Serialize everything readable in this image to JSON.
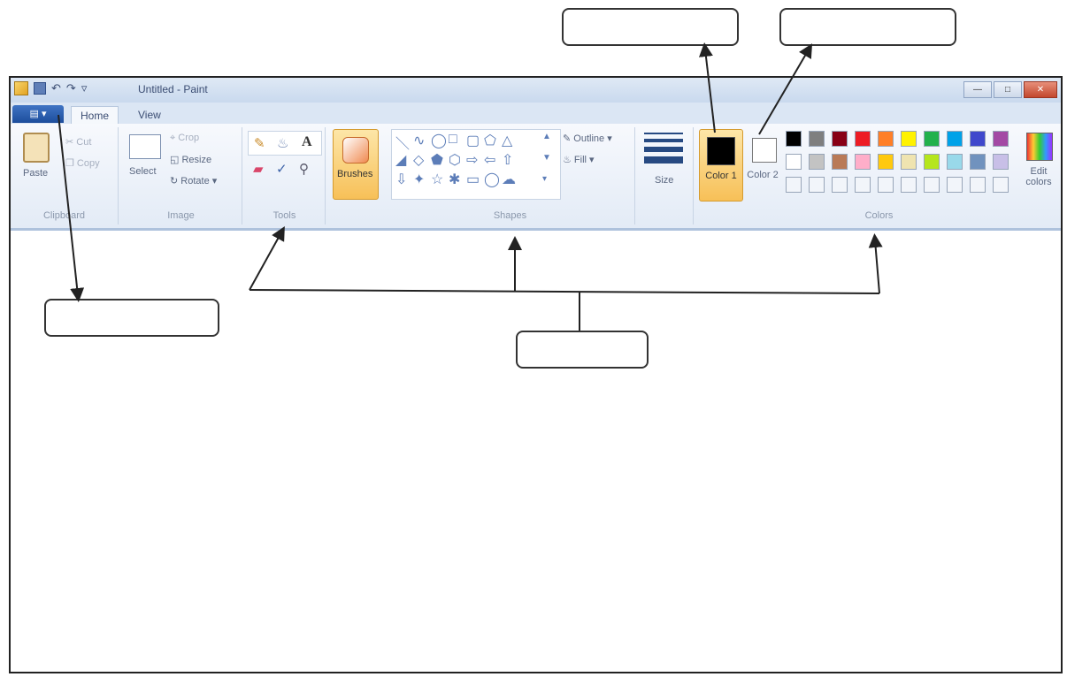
{
  "window": {
    "title": "Untitled - Paint",
    "controls": {
      "minimize": "—",
      "maximize": "□",
      "close": "✕"
    }
  },
  "file_menu": {
    "label": "▤ ▾"
  },
  "tabs": [
    {
      "label": "Home"
    },
    {
      "label": "View"
    }
  ],
  "ribbon": {
    "clipboard": {
      "label": "Clipboard",
      "paste": "Paste",
      "cut": "Cut",
      "copy": "Copy"
    },
    "image": {
      "label": "Image",
      "select": "Select",
      "crop": "Crop",
      "resize": "Resize",
      "rotate": "Rotate ▾"
    },
    "tools": {
      "label": "Tools"
    },
    "brushes": {
      "label": "Brushes"
    },
    "shapes": {
      "label": "Shapes",
      "outline": "Outline ▾",
      "fill": "Fill ▾"
    },
    "size": {
      "label": "Size"
    },
    "colors": {
      "label": "Colors",
      "color1": "Color 1",
      "color2": "Color 2",
      "edit": "Edit colors",
      "row1": [
        "#000000",
        "#7f7f7f",
        "#880015",
        "#ed1c24",
        "#ff7f27",
        "#fff200",
        "#22b14c",
        "#00a2e8",
        "#3f48cc",
        "#a349a4"
      ],
      "row2": [
        "#ffffff",
        "#c3c3c3",
        "#b97a57",
        "#ffaec9",
        "#ffc90e",
        "#efe4b0",
        "#b5e61d",
        "#99d9ea",
        "#7092be",
        "#c8bfe7"
      ]
    }
  },
  "icons": [
    "paint-app-icon",
    "save-icon",
    "undo-icon",
    "redo-icon",
    "customize-icon",
    "pencil-icon",
    "fill-bucket-icon",
    "text-icon",
    "eraser-icon",
    "color-picker-icon",
    "magnifier-icon",
    "brush-icon",
    "edit-colors-icon"
  ]
}
